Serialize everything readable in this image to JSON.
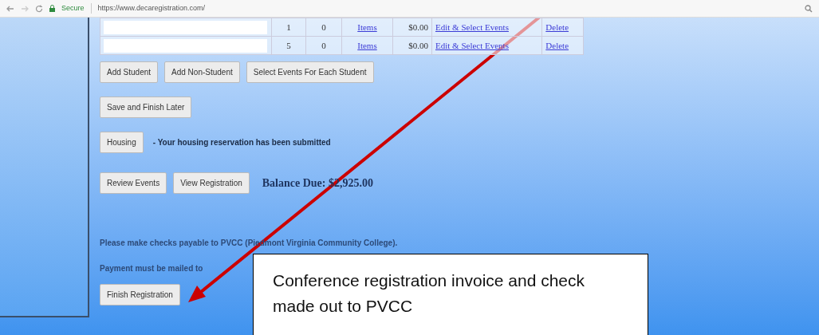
{
  "browser": {
    "security_label": "Secure",
    "url": "https://www.decaregistration.com/"
  },
  "table": {
    "rows": [
      {
        "column_2": "1",
        "column_3": "0",
        "items_link": "Items",
        "amount": "$0.00",
        "edit_link": "Edit & Select Events",
        "delete_link": "Delete"
      },
      {
        "column_2": "5",
        "column_3": "0",
        "items_link": "Items",
        "amount": "$0.00",
        "edit_link": "Edit & Select Events",
        "delete_link": "Delete"
      }
    ]
  },
  "student_buttons": [
    "Add Student",
    "Add Non-Student",
    "Select Events For Each Student"
  ],
  "save_button": "Save and Finish Later",
  "housing": {
    "button": "Housing",
    "status": "- Your housing reservation has been submitted"
  },
  "review_buttons": [
    "Review Events",
    "View Registration"
  ],
  "balance": "Balance Due: $2,925.00",
  "notes": [
    "Please make checks payable to PVCC (Piedmont Virginia Community College).",
    "Payment must be mailed to"
  ],
  "finish_button": "Finish Registration",
  "callout": "Conference registration invoice and check made out to PVCC"
}
